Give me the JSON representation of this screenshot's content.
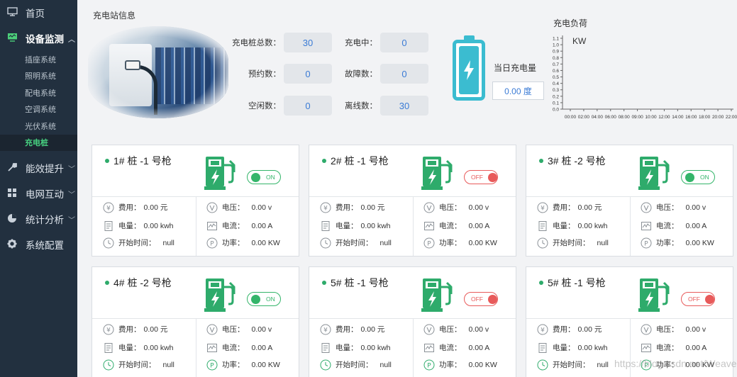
{
  "sidebar": {
    "home": "首页",
    "device_monitor": "设备监测",
    "sub_items": [
      "插座系统",
      "照明系统",
      "配电系统",
      "空调系统",
      "光伏系统",
      "充电桩"
    ],
    "efficiency": "能效提升",
    "grid": "电网互动",
    "stats": "统计分析",
    "config": "系统配置"
  },
  "station": {
    "title": "充电站信息",
    "total_label": "充电桩总数：",
    "total_value": "30",
    "charging_label": "充电中：",
    "charging_value": "0",
    "reserved_label": "预约数：",
    "reserved_value": "0",
    "fault_label": "故障数：",
    "fault_value": "0",
    "idle_label": "空闲数：",
    "idle_value": "0",
    "offline_label": "离线数：",
    "offline_value": "30",
    "today_label": "当日充电量",
    "today_value": "0.00 度"
  },
  "chart_data": {
    "type": "line",
    "title": "充电负荷",
    "ylabel": "KW",
    "x": [
      "00:00",
      "02:00",
      "04:00",
      "06:00",
      "08:00",
      "09:00",
      "10:00",
      "12:00",
      "14:00",
      "16:00",
      "18:00",
      "20:00",
      "22:00"
    ],
    "yticks": [
      "0.0",
      "0.1",
      "0.2",
      "0.3",
      "0.4",
      "0.5",
      "0.6",
      "0.7",
      "0.8",
      "0.9",
      "1.0",
      "1.1"
    ],
    "ylim": [
      0,
      1.1
    ],
    "series": [
      {
        "values": []
      }
    ]
  },
  "labels": {
    "fee": "费用：",
    "energy": "电量：",
    "start": "开始时间：",
    "voltage": "电压：",
    "current": "电流：",
    "power": "功率："
  },
  "cards": [
    {
      "title": "1# 桩 -1 号枪",
      "state": "ON",
      "fee": "0.00 元",
      "energy": "0.00 kwh",
      "start": "null",
      "voltage": "0.00 v",
      "current": "0.00 A",
      "power": "0.00 KW"
    },
    {
      "title": "2# 桩 -1 号枪",
      "state": "OFF",
      "fee": "0.00 元",
      "energy": "0.00 kwh",
      "start": "null",
      "voltage": "0.00 v",
      "current": "0.00 A",
      "power": "0.00 KW"
    },
    {
      "title": "3# 桩 -2 号枪",
      "state": "ON",
      "fee": "0.00 元",
      "energy": "0.00 kwh",
      "start": "null",
      "voltage": "0.00 v",
      "current": "0.00 A",
      "power": "0.00 KW"
    },
    {
      "title": "4# 桩 -2 号枪",
      "state": "ON",
      "fee": "0.00 元",
      "energy": "0.00 kwh",
      "start": "null",
      "voltage": "0.00 v",
      "current": "0.00 A",
      "power": "0.00 KW"
    },
    {
      "title": "5# 桩 -1 号枪",
      "state": "OFF",
      "fee": "0.00 元",
      "energy": "0.00 kwh",
      "start": "null",
      "voltage": "0.00 v",
      "current": "0.00 A",
      "power": "0.00 KW"
    },
    {
      "title": "5# 桩 -1 号枪",
      "state": "OFF",
      "fee": "0.00 元",
      "energy": "0.00 kwh",
      "start": "null",
      "voltage": "0.00 v",
      "current": "0.00 A",
      "power": "0.00 KW"
    }
  ],
  "watermark": "https://blog.csdn.net/Weaver",
  "colors": {
    "sidebar": "#22303f",
    "accent_green": "#2eab6b",
    "off_red": "#e85a5a",
    "battery": "#3bbcd0",
    "value_blue": "#3a7bd5"
  }
}
